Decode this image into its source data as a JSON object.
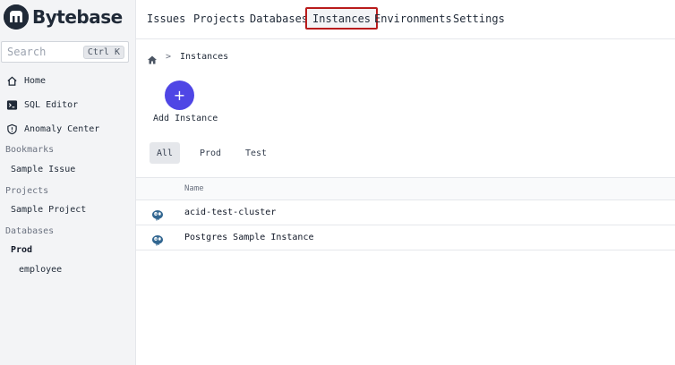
{
  "brand": {
    "name": "Bytebase"
  },
  "search": {
    "placeholder": "Search",
    "shortcut": "Ctrl K"
  },
  "sidebar": {
    "items": [
      {
        "label": "Home",
        "icon": "home-icon"
      },
      {
        "label": "SQL Editor",
        "icon": "terminal-icon"
      },
      {
        "label": "Anomaly Center",
        "icon": "shield-icon"
      }
    ],
    "bookmarks": {
      "header": "Bookmarks",
      "items": [
        "Sample Issue"
      ]
    },
    "projects": {
      "header": "Projects",
      "items": [
        "Sample Project"
      ]
    },
    "databases": {
      "header": "Databases",
      "group": "Prod",
      "items": [
        "employee"
      ]
    }
  },
  "topnav": {
    "items": [
      "Issues",
      "Projects",
      "Databases",
      "Instances",
      "Environments",
      "Settings"
    ],
    "active": "Instances"
  },
  "breadcrumb": {
    "sep": ">",
    "current": "Instances"
  },
  "actions": {
    "add_instance": "Add Instance",
    "add_symbol": "+"
  },
  "tabs": [
    "All",
    "Prod",
    "Test"
  ],
  "table": {
    "columns": [
      "Name"
    ],
    "rows": [
      {
        "name": "acid-test-cluster",
        "engine_icon": "postgres-icon"
      },
      {
        "name": "Postgres Sample Instance",
        "engine_icon": "postgres-icon"
      }
    ]
  },
  "colors": {
    "accent": "#4f46e5",
    "active_outline": "#b91c1c",
    "sidebar_bg": "#f3f4f6"
  }
}
